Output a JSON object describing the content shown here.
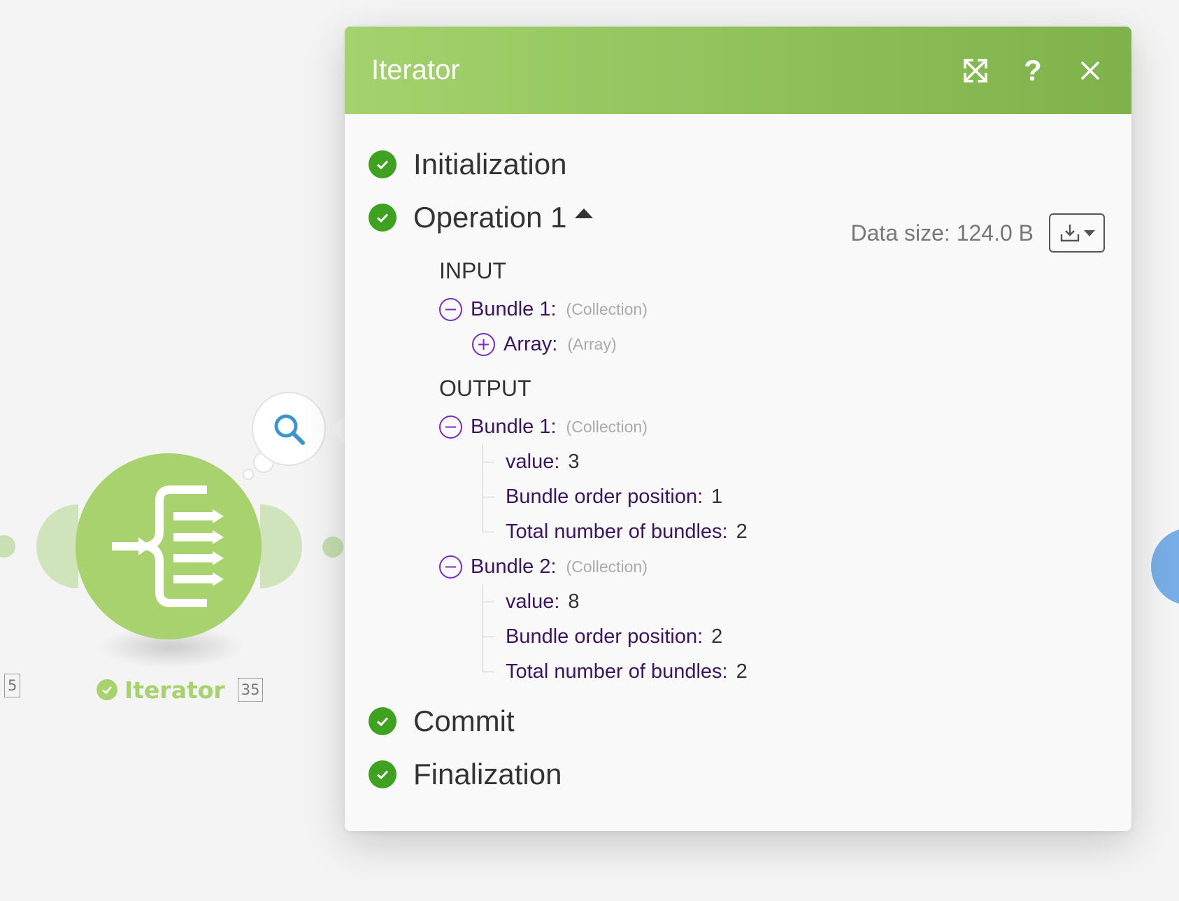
{
  "module": {
    "name": "Iterator",
    "left_count": "5",
    "right_count": "35",
    "accent_color": "#a7d26e"
  },
  "panel": {
    "title": "Iterator",
    "header_gradient": [
      "#a4d26e",
      "#7eb24a"
    ],
    "icons": [
      "expand-icon",
      "help-icon",
      "close-icon"
    ],
    "help_glyph": "?",
    "phases": {
      "initialization": "Initialization",
      "operation": "Operation 1",
      "commit": "Commit",
      "finalization": "Finalization"
    },
    "data_size": "Data size: 124.0 B",
    "input": {
      "title": "INPUT",
      "bundle_label": "Bundle 1:",
      "bundle_type": "(Collection)",
      "array_label": "Array:",
      "array_type": "(Array)"
    },
    "output": {
      "title": "OUTPUT",
      "bundles": [
        {
          "label": "Bundle 1:",
          "type": "(Collection)",
          "fields": [
            {
              "key": "value:",
              "value": "3"
            },
            {
              "key": "Bundle order position:",
              "value": "1"
            },
            {
              "key": "Total number of bundles:",
              "value": "2"
            }
          ]
        },
        {
          "label": "Bundle 2:",
          "type": "(Collection)",
          "fields": [
            {
              "key": "value:",
              "value": "8"
            },
            {
              "key": "Bundle order position:",
              "value": "2"
            },
            {
              "key": "Total number of bundles:",
              "value": "2"
            }
          ]
        }
      ]
    },
    "success_color": "#3ea11f",
    "tree_key_color": "#3d1461",
    "toggle_color": "#7a2bc2"
  }
}
